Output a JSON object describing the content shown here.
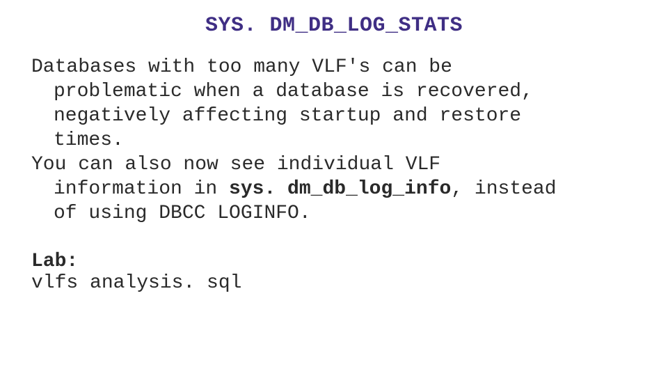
{
  "title": "SYS. DM_DB_LOG_STATS",
  "p1_line1": "Databases with too many VLF's can be",
  "p1_line2": "problematic when a database is recovered,",
  "p1_line3": "negatively affecting startup and restore",
  "p1_line4": "times.",
  "p2_line1": "You can also now see individual VLF",
  "p2_line2a": "information in ",
  "p2_line2b": "sys. dm_db_log_info",
  "p2_line2c": ", instead",
  "p2_line3": "of using DBCC LOGINFO.",
  "lab_label": "Lab:",
  "lab_file": "vlfs analysis. sql"
}
